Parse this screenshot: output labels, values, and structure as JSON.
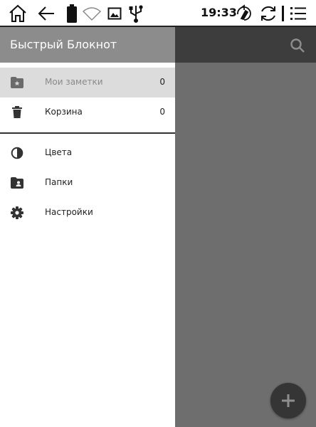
{
  "status_bar": {
    "time": "19:33",
    "icons": [
      "home-icon",
      "back-arrow-icon",
      "battery-icon",
      "wifi-icon",
      "image-icon",
      "usb-icon",
      "sync-brush-icon",
      "refresh-icon",
      "menu-icon"
    ]
  },
  "drawer": {
    "title": "Быстрый Блокнот",
    "items": [
      {
        "label": "Мои заметки",
        "count": "0",
        "icon": "folder-star-icon",
        "active": true
      },
      {
        "label": "Корзина",
        "count": "0",
        "icon": "trash-icon",
        "active": false
      }
    ],
    "secondary_items": [
      {
        "label": "Цвета",
        "icon": "color-drop-icon"
      },
      {
        "label": "Папки",
        "icon": "folder-account-icon"
      },
      {
        "label": "Настройки",
        "icon": "gear-icon"
      }
    ]
  },
  "content": {
    "search_icon": "search-icon",
    "fab_icon": "plus-icon"
  },
  "colors": {
    "drawer_header": "#8c8c8c",
    "content_appbar": "#3d3d3d",
    "content_scrim": "#6e6e6e",
    "active_item": "#dcdcdc",
    "fab": "#353535"
  }
}
